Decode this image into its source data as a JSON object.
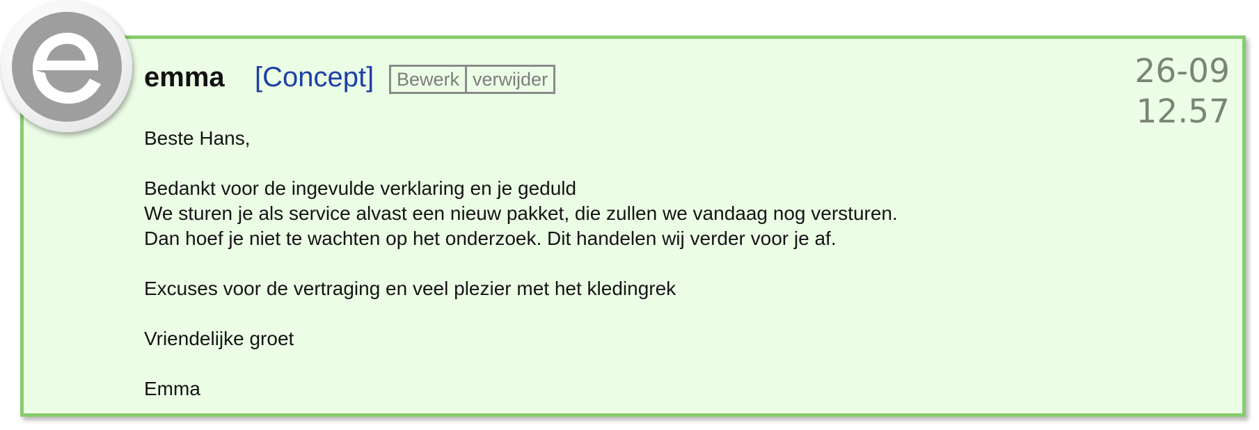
{
  "message": {
    "author": "emma",
    "status": "[Concept]",
    "actions": {
      "edit_label": "Bewerk",
      "delete_label": "verwijder"
    },
    "date": "26-09",
    "time": "12.57",
    "avatar_icon": "emma-logo-e-icon",
    "body_lines": [
      "Beste Hans,",
      "",
      "Bedankt voor de ingevulde verklaring en je geduld",
      "We sturen je als service alvast een nieuw pakket, die zullen we vandaag nog versturen.",
      "Dan hoef je niet te wachten op het onderzoek. Dit handelen wij verder voor je af.",
      "",
      "Excuses voor de vertraging en veel plezier met het kledingrek",
      "",
      "Vriendelijke groet",
      "",
      "Emma"
    ]
  },
  "colors": {
    "card_background": "#ecfde6",
    "card_border": "#87cc6f",
    "status_text": "#1b3fa6",
    "timestamp_text": "#7a8474",
    "action_text": "#7c7c7c"
  }
}
